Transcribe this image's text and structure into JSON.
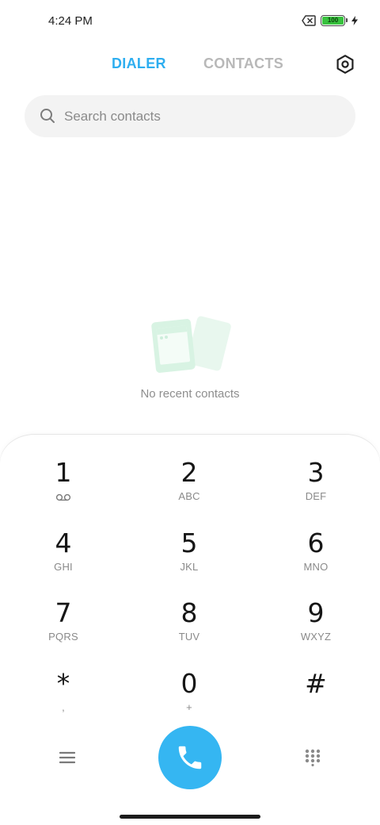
{
  "status": {
    "time": "4:24 PM",
    "battery_level": "100",
    "icons": [
      "no-sim-icon",
      "battery-icon",
      "charging-bolt-icon"
    ],
    "battery_color": "#38c23e"
  },
  "tabs": [
    {
      "label": "DIALER",
      "active": true
    },
    {
      "label": "CONTACTS",
      "active": false
    }
  ],
  "settings": {
    "icon": "settings-hexagon-icon"
  },
  "search": {
    "placeholder": "Search contacts",
    "value": ""
  },
  "empty_state": {
    "text": "No recent contacts",
    "icon": "contact-cards-illustration"
  },
  "keypad": [
    {
      "digit": "1",
      "letters": ""
    },
    {
      "digit": "2",
      "letters": "ABC"
    },
    {
      "digit": "3",
      "letters": "DEF"
    },
    {
      "digit": "4",
      "letters": "GHI"
    },
    {
      "digit": "5",
      "letters": "JKL"
    },
    {
      "digit": "6",
      "letters": "MNO"
    },
    {
      "digit": "7",
      "letters": "PQRS"
    },
    {
      "digit": "8",
      "letters": "TUV"
    },
    {
      "digit": "9",
      "letters": "WXYZ"
    },
    {
      "digit": "*",
      "letters": ","
    },
    {
      "digit": "0",
      "letters": "+"
    },
    {
      "digit": "#",
      "letters": ""
    }
  ],
  "bottom_bar": {
    "menu_icon": "hamburger-menu-icon",
    "call_icon": "phone-icon",
    "dialpad_icon": "dialpad-grid-icon"
  },
  "colors": {
    "accent": "#2eaef0",
    "call_button": "#35b6f2",
    "inactive_tab": "#b8b8b8",
    "search_bg": "#f3f3f3",
    "illustration": "#d8f3e3"
  }
}
